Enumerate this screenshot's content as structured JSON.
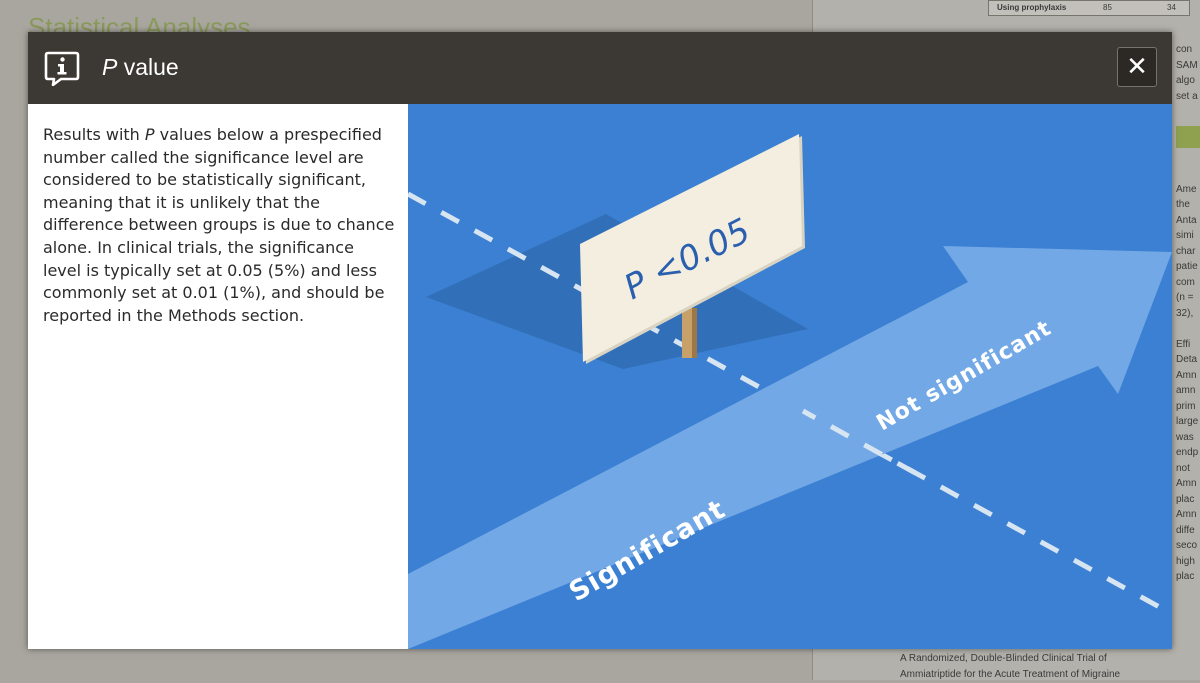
{
  "background": {
    "doc_title": "Statistical Analyses",
    "table_label": "Using prophylaxis",
    "table_val1": "85",
    "table_val2": "34",
    "right_lines": [
      "con",
      "SAM",
      "algo",
      "set a",
      "",
      "",
      "",
      "",
      "",
      "Ame",
      "the",
      "Anta",
      "simi",
      "char",
      "patie",
      "com",
      "(n =",
      "32),",
      "",
      "Effi",
      "Deta",
      "Amn",
      "amn",
      "prim",
      "large",
      "was",
      "endp",
      "not",
      "Amn",
      "plac",
      "Amn",
      "diffe",
      "seco",
      "high",
      "plac"
    ],
    "citation_line1": "A Randomized, Double-Blinded Clinical Trial of",
    "citation_line2": "Ammiatriptide for the Acute Treatment of Migraine"
  },
  "modal": {
    "title_italic": "P",
    "title_rest": " value",
    "close_label": "✕",
    "icon": "info-speech-bubble-icon",
    "description": {
      "p_italic": "P",
      "before": "Results with ",
      "after": " values below a prespecified number called the significance level are considered to be statistically significant, meaning that it is unlikely that the difference between groups is due to chance alone. In clinical trials, the significance level is typically set at 0.05 (5%) and less commonly set at 0.01 (1%), and should be reported in the Methods section."
    },
    "illustration": {
      "sign_text": "P <0.05",
      "arrow_label_left": "Significant",
      "arrow_label_right": "Not significant",
      "colors": {
        "background": "#3b80d2",
        "shadow": "#3170b9",
        "arrow": "#73a8e6",
        "sign": "#f3eedf",
        "sign_text": "#2a5fb0",
        "post": "#c8a06a"
      }
    }
  }
}
